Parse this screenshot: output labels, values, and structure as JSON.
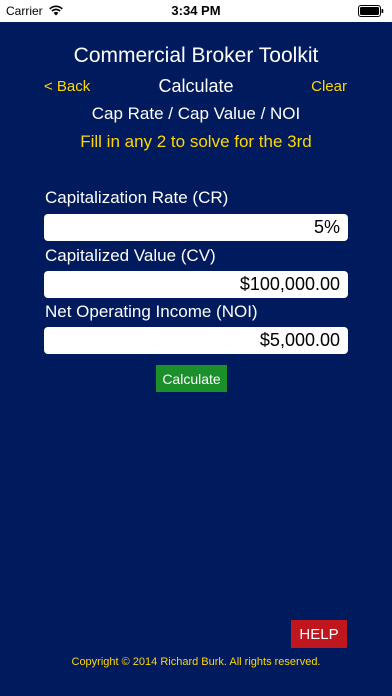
{
  "status_bar": {
    "carrier": "Carrier",
    "time": "3:34 PM",
    "wifi_icon": "wifi-icon",
    "battery_icon": "battery-icon"
  },
  "header": {
    "app_title": "Commercial Broker Toolkit",
    "back_label": "< Back",
    "screen_title": "Calculate",
    "clear_label": "Clear",
    "subtitle": "Cap Rate / Cap Value / NOI",
    "instructions": "Fill in any 2 to solve for the 3rd"
  },
  "fields": [
    {
      "label": "Capitalization Rate (CR)",
      "value": "5%"
    },
    {
      "label": "Capitalized Value (CV)",
      "value": "$100,000.00"
    },
    {
      "label": "Net Operating Income (NOI)",
      "value": "$5,000.00"
    }
  ],
  "actions": {
    "calculate_label": "Calculate",
    "help_label": "HELP"
  },
  "footer": {
    "copyright": "Copyright ©  2014 Richard Burk. All rights reserved."
  },
  "colors": {
    "background": "#001a5e",
    "accent": "#ffd700",
    "calculate_button": "#1a8f2a",
    "help_button": "#c0161e"
  }
}
